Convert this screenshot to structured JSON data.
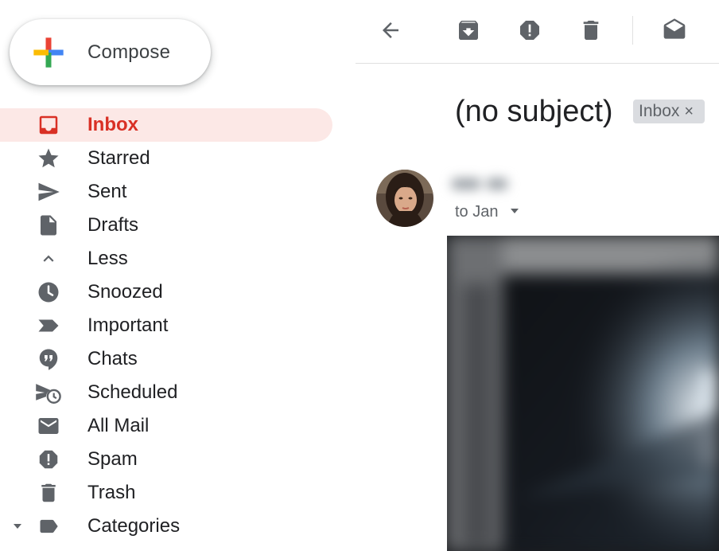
{
  "compose": {
    "label": "Compose"
  },
  "sidebar": {
    "items": [
      {
        "label": "Inbox",
        "icon": "inbox-icon",
        "active": true
      },
      {
        "label": "Starred",
        "icon": "star-icon"
      },
      {
        "label": "Sent",
        "icon": "send-icon"
      },
      {
        "label": "Drafts",
        "icon": "draft-icon"
      },
      {
        "label": "Less",
        "icon": "chevron-up-icon"
      },
      {
        "label": "Snoozed",
        "icon": "clock-icon"
      },
      {
        "label": "Important",
        "icon": "important-icon"
      },
      {
        "label": "Chats",
        "icon": "chat-icon"
      },
      {
        "label": "Scheduled",
        "icon": "scheduled-send-icon"
      },
      {
        "label": "All Mail",
        "icon": "envelope-icon"
      },
      {
        "label": "Spam",
        "icon": "spam-icon"
      },
      {
        "label": "Trash",
        "icon": "trash-icon"
      },
      {
        "label": "Categories",
        "icon": "label-icon"
      }
    ]
  },
  "toolbar": {
    "buttons": [
      "back-arrow-icon",
      "archive-icon",
      "report-spam-icon",
      "delete-icon",
      "mark-unread-icon"
    ]
  },
  "message": {
    "subject": "(no subject)",
    "label_chip": "Inbox",
    "label_chip_remove": "×",
    "recipient": "to Jan"
  },
  "colors": {
    "active_text": "#d93025",
    "active_bg": "#fce8e6",
    "icon_gray": "#5f6368",
    "chip_bg": "#dadce0"
  }
}
